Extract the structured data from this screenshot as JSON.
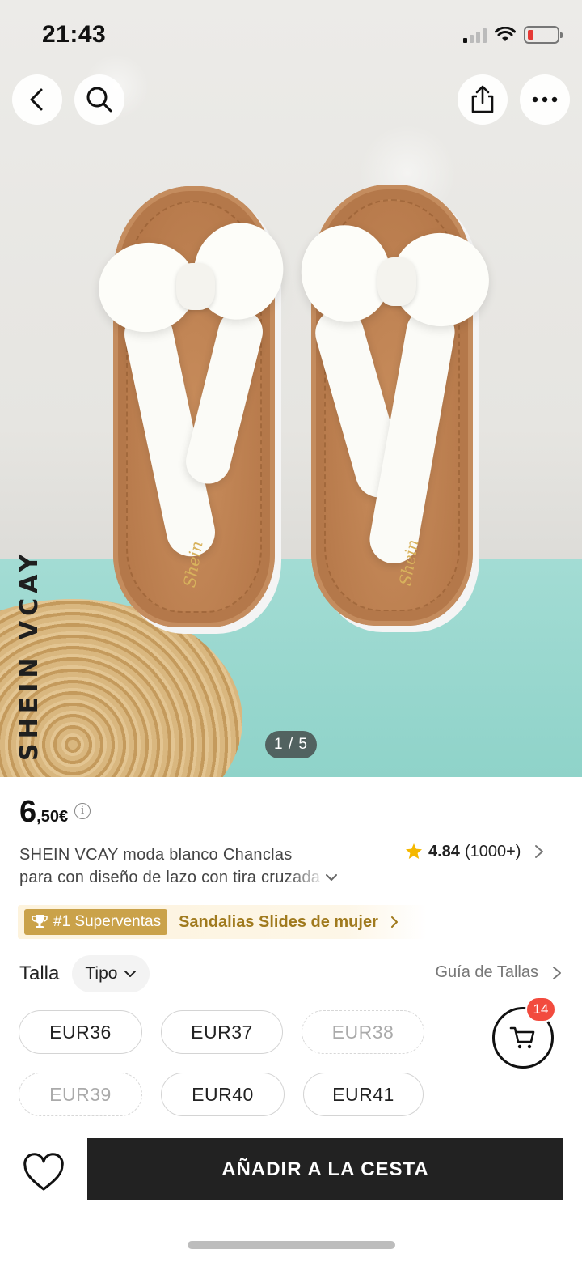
{
  "status_bar": {
    "time": "21:43",
    "battery_color": "#e53935"
  },
  "product_image": {
    "brand_watermark": "SHEIN VCAY",
    "sole_logo": "Shein",
    "pager": "1 / 5"
  },
  "top_actions": {
    "back": "chevron-left-icon",
    "search": "search-icon",
    "share": "share-icon",
    "more": "more-horizontal-icon"
  },
  "product": {
    "price_int": "6",
    "price_dec": ",50€",
    "price_info": "i",
    "title_line1": "SHEIN VCAY moda blanco Chanclas",
    "title_line2": "para con diseño de lazo con tira cruzada",
    "rating_value": "4.84",
    "rating_count": "(1000+)",
    "rating_star_color": "#f5b800"
  },
  "bestseller": {
    "tag": "#1 Superventas",
    "category": "Sandalias Slides de mujer",
    "tag_color": "#caa24a"
  },
  "size_section": {
    "label": "Talla",
    "type_selector": "Tipo",
    "guide": "Guía de Tallas",
    "sizes": [
      {
        "label": "EUR36",
        "available": true
      },
      {
        "label": "EUR37",
        "available": true
      },
      {
        "label": "EUR38",
        "available": false
      },
      {
        "label": "EUR39",
        "available": false
      },
      {
        "label": "EUR40",
        "available": true
      },
      {
        "label": "EUR41",
        "available": true
      }
    ]
  },
  "cart": {
    "badge_count": "14",
    "badge_color": "#f24b3e"
  },
  "bottom_bar": {
    "add_to_cart": "AÑADIR A LA CESTA",
    "wishlist": "heart-icon"
  }
}
